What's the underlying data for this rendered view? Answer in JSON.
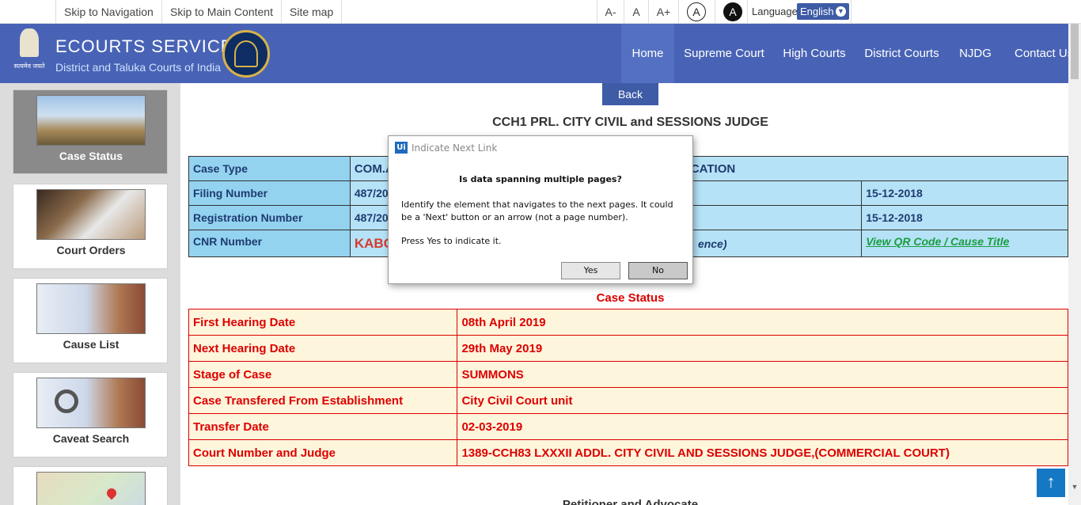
{
  "topbar": {
    "skip_nav": "Skip to Navigation",
    "skip_main": "Skip to Main Content",
    "sitemap": "Site map",
    "font_decrease": "A-",
    "font_normal": "A",
    "font_increase": "A+",
    "contrast_light": "A",
    "contrast_dark": "A",
    "language_label": "Language",
    "language_value": "English"
  },
  "header": {
    "title": "ECOURTS SERVICES",
    "subtitle": "District and Taluka Courts of India",
    "emblem_text": "सत्यमेव जयते",
    "nav": [
      "Home",
      "Supreme Court",
      "High Courts",
      "District Courts",
      "NJDG",
      "Contact Us"
    ]
  },
  "sidebar": {
    "items": [
      "Case Status",
      "Court Orders",
      "Cause List",
      "Caveat Search"
    ]
  },
  "main": {
    "back_label": "Back",
    "court_title": "CCH1 PRL. CITY CIVIL and SESSIONS JUDGE",
    "info": {
      "case_type_label": "Case Type",
      "case_type_value": "COM.A",
      "case_type_value_tail": "CATION",
      "filing_label": "Filing Number",
      "filing_value": "487/20",
      "filing_date": "15-12-2018",
      "registration_label": "Registration Number",
      "registration_value": "487/20",
      "registration_date": "15-12-2018",
      "cnr_label": "CNR Number",
      "cnr_value": "KABC",
      "cnr_tail": "ence)",
      "qr_link": "View QR Code / Cause Title"
    },
    "status_heading": "Case Status",
    "status_rows": [
      {
        "label": "First Hearing Date",
        "value": "08th April 2019"
      },
      {
        "label": "Next Hearing Date",
        "value": "29th May 2019"
      },
      {
        "label": "Stage of Case",
        "value": "SUMMONS"
      },
      {
        "label": "Case Transfered From Establishment",
        "value": "City Civil Court unit"
      },
      {
        "label": "Transfer Date",
        "value": "02-03-2019"
      },
      {
        "label": "Court Number and Judge",
        "value": "1389-CCH83 LXXXII ADDL. CITY CIVIL AND SESSIONS JUDGE,(COMMERCIAL COURT)"
      }
    ],
    "petitioner_heading": "Petitioner and Advocate"
  },
  "dialog": {
    "logo": "Ui",
    "title": "Indicate Next Link",
    "question": "Is data spanning multiple pages?",
    "body": "Identify the element that navigates to the next pages. It could be a 'Next' button or an arrow (not a page number).",
    "press": "Press Yes to indicate it.",
    "yes": "Yes",
    "no": "No"
  },
  "icons": {
    "scroll_top": "arrow-up-icon",
    "scroll_up": "chevron-up-icon",
    "scroll_down": "chevron-down-icon"
  }
}
